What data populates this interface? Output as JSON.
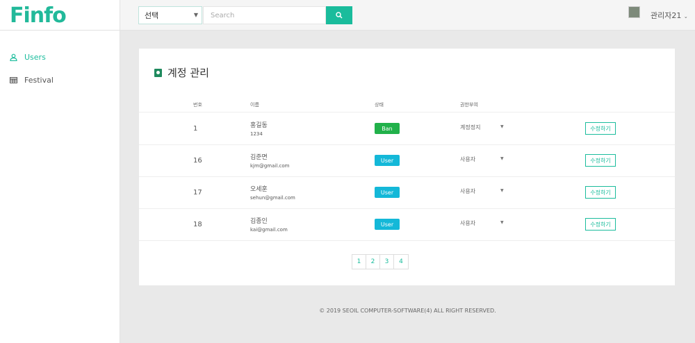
{
  "brand": {
    "logo_text": "Finfo"
  },
  "topbar": {
    "select_label": "선택",
    "search_placeholder": "Search",
    "admin_label": "관리자21"
  },
  "sidebar": {
    "items": [
      {
        "label": "Users",
        "icon": "user-icon",
        "active": true
      },
      {
        "label": "Festival",
        "icon": "table-icon",
        "active": false
      }
    ]
  },
  "page": {
    "title": "계정 관리",
    "columns": [
      "번호",
      "이름",
      "상태",
      "권한부여"
    ],
    "rows": [
      {
        "num": "1",
        "name": "홍길동",
        "email": "1234",
        "status": "Ban",
        "status_color": "#21b14a",
        "perm": "계정정지",
        "edit": "수정하기"
      },
      {
        "num": "16",
        "name": "김준면",
        "email": "kjm@gmail.com",
        "status": "User",
        "status_color": "#14b8d8",
        "perm": "사용자",
        "edit": "수정하기"
      },
      {
        "num": "17",
        "name": "오세훈",
        "email": "sehun@gmail.com",
        "status": "User",
        "status_color": "#14b8d8",
        "perm": "사용자",
        "edit": "수정하기"
      },
      {
        "num": "18",
        "name": "김종인",
        "email": "kai@gmail.com",
        "status": "User",
        "status_color": "#14b8d8",
        "perm": "사용자",
        "edit": "수정하기"
      }
    ],
    "pages": [
      "1",
      "2",
      "3",
      "4"
    ]
  },
  "footer": {
    "text": "© 2019 SEOIL COMPUTER-SOFTWARE(4) ALL RIGHT RESERVED."
  },
  "colors": {
    "accent": "#1abc9c"
  }
}
